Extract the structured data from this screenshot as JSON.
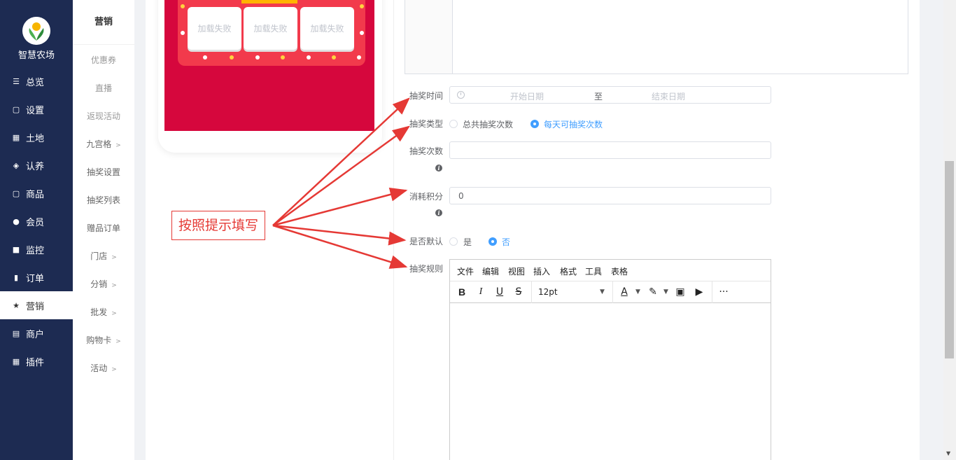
{
  "brand": {
    "name": "智慧农场"
  },
  "nav": [
    {
      "label": "总览",
      "icon": "sliders-icon"
    },
    {
      "label": "设置",
      "icon": "bag-icon"
    },
    {
      "label": "土地",
      "icon": "grid-icon"
    },
    {
      "label": "认养",
      "icon": "diamond-icon"
    },
    {
      "label": "商品",
      "icon": "bag-icon"
    },
    {
      "label": "会员",
      "icon": "user-icon"
    },
    {
      "label": "监控",
      "icon": "camera-icon"
    },
    {
      "label": "订单",
      "icon": "clipboard-icon"
    },
    {
      "label": "营销",
      "icon": "star-icon",
      "active": true
    },
    {
      "label": "商户",
      "icon": "store-icon"
    },
    {
      "label": "插件",
      "icon": "grid-icon"
    }
  ],
  "subnav": {
    "title": "营销",
    "items": [
      {
        "label": "优惠券"
      },
      {
        "label": "直播"
      },
      {
        "label": "返现活动"
      },
      {
        "label": "九宫格",
        "chevron": true
      },
      {
        "label": "抽奖设置"
      },
      {
        "label": "抽奖列表"
      },
      {
        "label": "赠品订单"
      },
      {
        "label": "门店",
        "chevron": true
      },
      {
        "label": "分销",
        "chevron": true
      },
      {
        "label": "批发",
        "chevron": true
      },
      {
        "label": "购物卡",
        "chevron": true
      },
      {
        "label": "活动",
        "chevron": true
      }
    ]
  },
  "preview": {
    "cells": [
      "加载失败",
      "加载失败",
      "加载失败"
    ]
  },
  "form": {
    "time_label": "抽奖时间",
    "start_placeholder": "开始日期",
    "range_sep": "至",
    "end_placeholder": "结束日期",
    "type_label": "抽奖类型",
    "type_options": [
      "总共抽奖次数",
      "每天可抽奖次数"
    ],
    "type_selected": "每天可抽奖次数",
    "count_label": "抽奖次数",
    "count_value": "",
    "points_label": "消耗积分",
    "points_value": "0",
    "default_label": "是否默认",
    "default_options": [
      "是",
      "否"
    ],
    "default_selected": "否",
    "rules_label": "抽奖规则"
  },
  "editor": {
    "menus": [
      "文件",
      "编辑",
      "视图",
      "插入",
      "格式",
      "工具",
      "表格"
    ],
    "font_size": "12pt",
    "tools": [
      "bold-icon",
      "italic-icon",
      "underline-icon",
      "strikethrough-icon",
      "text-color-icon",
      "highlight-icon",
      "image-icon",
      "media-icon",
      "more-icon"
    ]
  },
  "annotation": {
    "text": "按照提示填写"
  },
  "colors": {
    "sidebar": "#1d2b52",
    "accent": "#409eff",
    "annotation": "#e53935",
    "preview_bg": "#d6073d"
  }
}
